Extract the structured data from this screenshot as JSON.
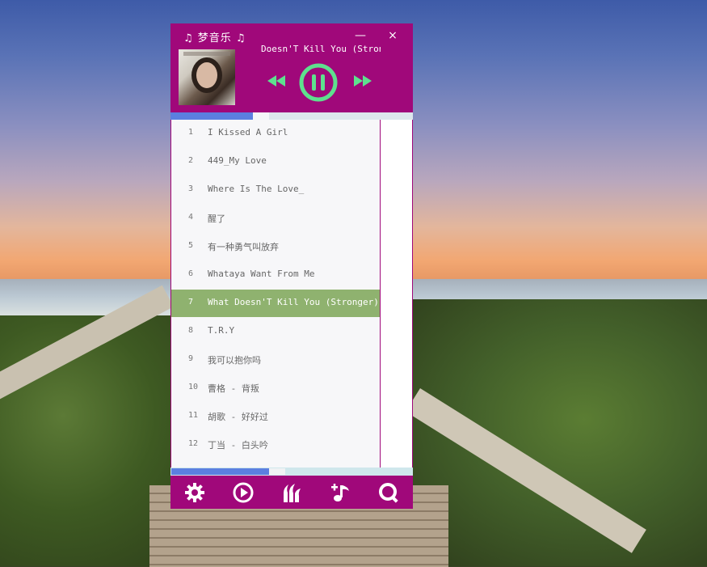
{
  "app": {
    "title": "♫ 梦音乐 ♫",
    "minimize_label": "—",
    "close_label": "×"
  },
  "now_playing": {
    "title": "Doesn'T Kill You (Stronger)",
    "progress": 0.34
  },
  "icons": {
    "prev": "rewind-icon",
    "play_pause": "pause-icon",
    "next": "fast-forward-icon",
    "settings": "gear-icon",
    "play": "play-circle-icon",
    "library": "wings-icon",
    "add_music": "add-music-icon",
    "search": "search-icon"
  },
  "colors": {
    "window_bg": "#a0087a",
    "accent_green": "#5ee08e",
    "active_row": "#8fb26f",
    "progress_fill": "#5b7fe0"
  },
  "playlist": {
    "items": [
      {
        "num": "1",
        "name": "I Kissed A Girl"
      },
      {
        "num": "2",
        "name": "449_My Love"
      },
      {
        "num": "3",
        "name": "Where Is The Love_"
      },
      {
        "num": "4",
        "name": "醒了"
      },
      {
        "num": "5",
        "name": "有一种勇气叫放弃"
      },
      {
        "num": "6",
        "name": "Whataya Want From Me"
      },
      {
        "num": "7",
        "name": "What Doesn'T Kill You (Stronger)"
      },
      {
        "num": "8",
        "name": "T.R.Y"
      },
      {
        "num": "9",
        "name": "我可以抱你吗"
      },
      {
        "num": "10",
        "name": " 曹格 - 背叛"
      },
      {
        "num": "11",
        "name": " 胡歌 - 好好过"
      },
      {
        "num": "12",
        "name": " 丁当 - 白头吟"
      }
    ],
    "active_index": 6,
    "scroll_progress": 0.4
  }
}
